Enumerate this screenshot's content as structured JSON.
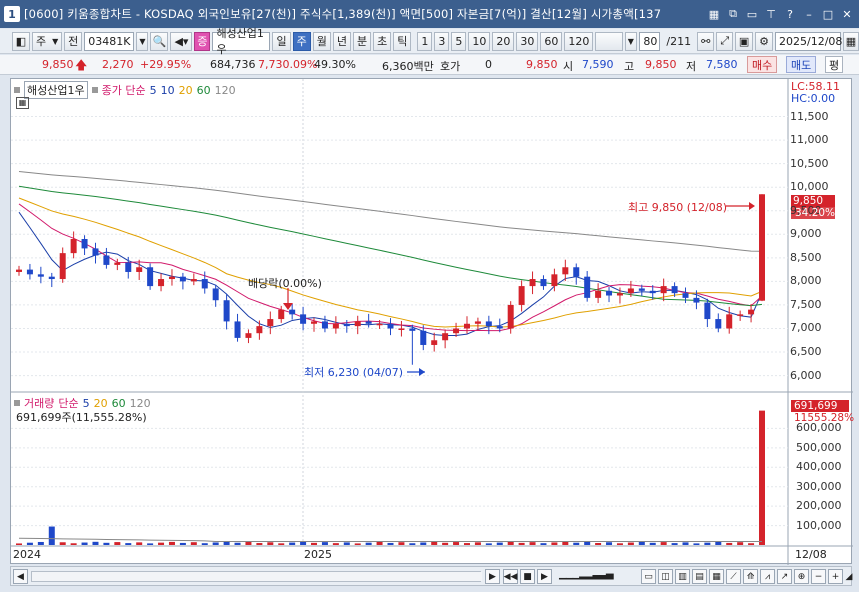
{
  "window": {
    "number": "1",
    "title": "[0600] 키움종합차트 - KOSDAQ 외국인보유[27(천)] 주식수[1,389(천)] 액면[500] 자본금[7(억)] 결산[12월] 시가총액[137"
  },
  "toolbar": {
    "period_select": "주",
    "market_select": "전",
    "stock_code": "03481K",
    "stock_name": "해성산업1우",
    "period_buttons": [
      "일",
      "주",
      "월",
      "년",
      "분",
      "초",
      "틱"
    ],
    "active_period": "주",
    "interval_buttons": [
      "1",
      "3",
      "5",
      "10",
      "20",
      "30",
      "60",
      "120"
    ],
    "count": "80",
    "total": "/211",
    "date": "2025/12/08"
  },
  "quote": {
    "price": "9,850",
    "change": "2,270",
    "change_pct": "+29.95%",
    "volume": "684,736",
    "volume_pct": "7,730.09%",
    "turnover": "49.30%",
    "amount": "6,360백만",
    "hoga_label": "호가",
    "hoga_value": "0",
    "hoga_price": "9,850",
    "open_label": "시",
    "open": "7,590",
    "high_label": "고",
    "high": "9,850",
    "low_label": "저",
    "low": "7,580",
    "buy_label": "매수",
    "sell_label": "매도",
    "flat_label": "평"
  },
  "price_panel": {
    "stock_tag": "해성산업1우",
    "ma_label": "종가 단순",
    "ma_periods": [
      "5",
      "10",
      "20",
      "60",
      "120"
    ],
    "ma_colors": [
      "#1a3ea8",
      "#d11a6b",
      "#e0a000",
      "#1e8a3a",
      "#888888"
    ],
    "lc": "LC:58.11",
    "hc": "HC:0.00",
    "price_ticks": [
      "11,500",
      "11,000",
      "10,500",
      "10,000",
      "9,500",
      "9,000",
      "8,500",
      "8,000",
      "7,500",
      "7,000",
      "6,500",
      "6,000"
    ],
    "last_price_tag": "9,850",
    "last_pct_tag": "34.20%",
    "high_annotation": "최고 9,850 (12/08)",
    "low_annotation": "최저 6,230 (04/07)",
    "dividend_annotation": "배당락(0.00%)"
  },
  "volume_panel": {
    "label": "거래량",
    "ma_label": "단순",
    "ma_periods": [
      "5",
      "20",
      "60",
      "120"
    ],
    "ma_colors": [
      "#1a3ea8",
      "#e0a000",
      "#1e8a3a",
      "#888888"
    ],
    "current": "691,699주(11,555.28%)",
    "last_tag": "691,699",
    "last_pct_tag": "11555.28%",
    "vol_ticks": [
      "600,000",
      "500,000",
      "400,000",
      "300,000",
      "200,000",
      "100,000"
    ]
  },
  "x_axis": {
    "labels": [
      "2024",
      "2025"
    ],
    "right_label": "12/08"
  },
  "chart_data": {
    "type": "candlestick",
    "timeframe": "weekly",
    "stock": "해성산업1우",
    "ylim": [
      5800,
      12000
    ],
    "last_candle": {
      "open": 7590,
      "high": 9850,
      "low": 7580,
      "close": 9850,
      "date": "12/08"
    },
    "high_point": {
      "value": 9850,
      "date": "12/08"
    },
    "low_point": {
      "value": 6230,
      "date": "04/07"
    },
    "closes": [
      8250,
      8150,
      8100,
      8050,
      8600,
      8900,
      8700,
      8550,
      8350,
      8400,
      8200,
      8300,
      7900,
      8050,
      8100,
      8000,
      8050,
      7850,
      7600,
      7150,
      6800,
      6900,
      7050,
      7200,
      7400,
      7300,
      7100,
      7150,
      7000,
      7100,
      7050,
      7150,
      7100,
      7100,
      7000,
      7000,
      6950,
      6650,
      6750,
      6900,
      7000,
      7100,
      7150,
      7050,
      7000,
      7500,
      7900,
      8050,
      7900,
      8150,
      8300,
      8100,
      7650,
      7800,
      7700,
      7750,
      7850,
      7800,
      7750,
      7900,
      7750,
      7650,
      7550,
      7200,
      7000,
      7300,
      7300,
      7400,
      9850
    ],
    "volume_last": 691699
  }
}
